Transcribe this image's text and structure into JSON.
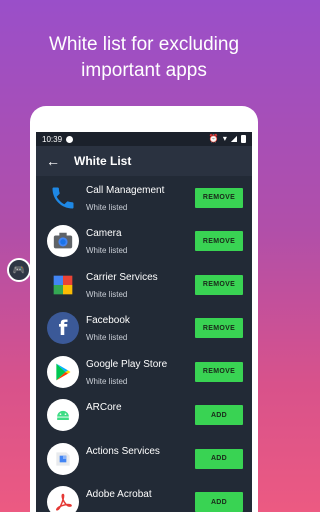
{
  "promo": {
    "line1": "White list for excluding",
    "line2": "important apps"
  },
  "statusbar": {
    "time": "10:39"
  },
  "appbar": {
    "title": "White List",
    "back_icon": "arrow-back-icon"
  },
  "apps": [
    {
      "name": "Call Management",
      "status": "White listed",
      "action": "REMOVE",
      "icon": "phone-icon",
      "icon_color": "#1e88e5"
    },
    {
      "name": "Camera",
      "status": "White listed",
      "action": "REMOVE",
      "icon": "camera-icon",
      "icon_color": "#ffffff"
    },
    {
      "name": "Carrier Services",
      "status": "White listed",
      "action": "REMOVE",
      "icon": "carrier-services-icon",
      "icon_color": "#4caf50"
    },
    {
      "name": "Facebook",
      "status": "White listed",
      "action": "REMOVE",
      "icon": "facebook-icon",
      "icon_color": "#3b5998"
    },
    {
      "name": "Google Play Store",
      "status": "White listed",
      "action": "REMOVE",
      "icon": "play-store-icon",
      "icon_color": "#ffffff"
    },
    {
      "name": "ARCore",
      "status": "",
      "action": "ADD",
      "icon": "android-icon",
      "icon_color": "#3ddc84"
    },
    {
      "name": "Actions Services",
      "status": "",
      "action": "ADD",
      "icon": "actions-services-icon",
      "icon_color": "#ffffff"
    },
    {
      "name": "Adobe Acrobat",
      "status": "",
      "action": "ADD",
      "icon": "adobe-acrobat-icon",
      "icon_color": "#ffffff"
    }
  ],
  "colors": {
    "button_green": "#39d353",
    "screen_bg": "#222a36",
    "appbar_bg": "#2a3240"
  }
}
